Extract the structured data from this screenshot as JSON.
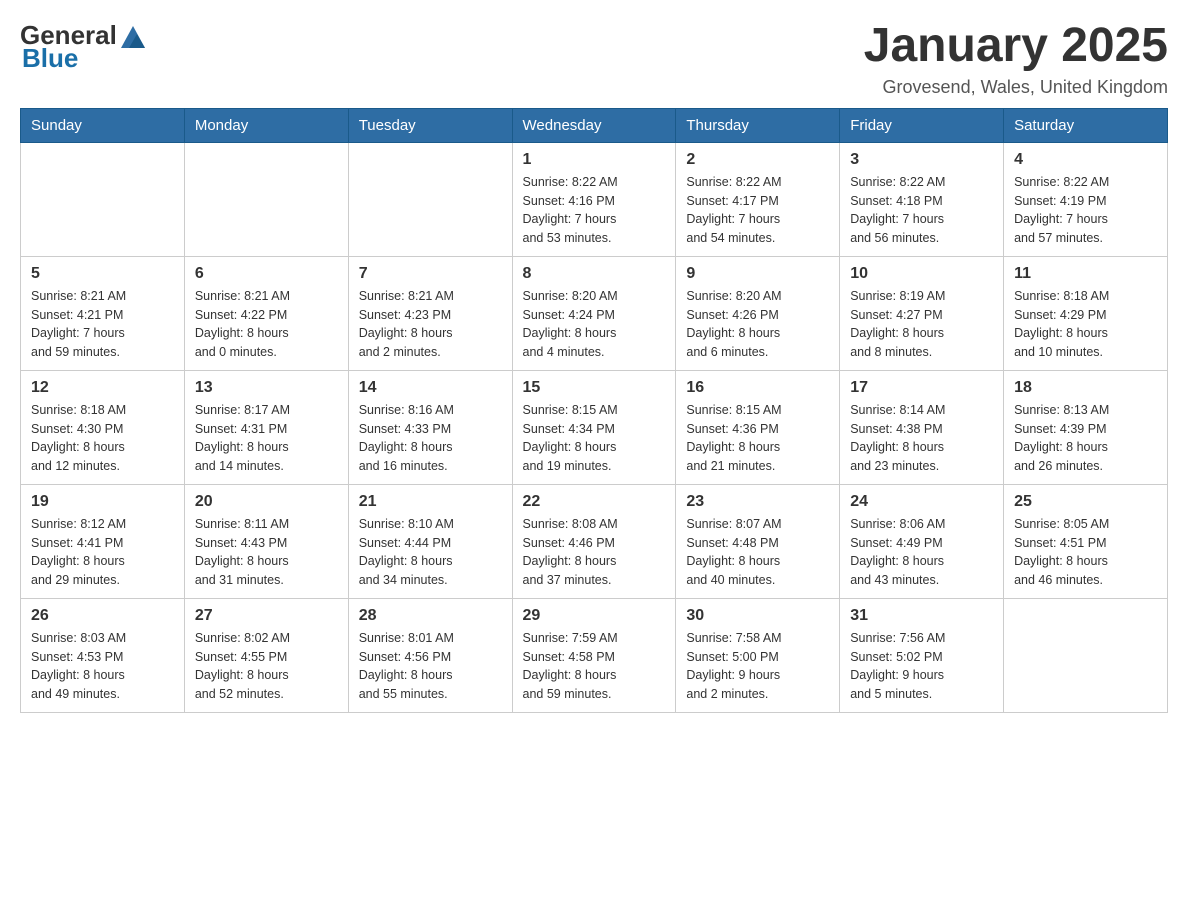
{
  "header": {
    "logo": {
      "general": "General",
      "blue": "Blue"
    },
    "title": "January 2025",
    "location": "Grovesend, Wales, United Kingdom"
  },
  "calendar": {
    "days_of_week": [
      "Sunday",
      "Monday",
      "Tuesday",
      "Wednesday",
      "Thursday",
      "Friday",
      "Saturday"
    ],
    "weeks": [
      [
        {
          "day": "",
          "info": ""
        },
        {
          "day": "",
          "info": ""
        },
        {
          "day": "",
          "info": ""
        },
        {
          "day": "1",
          "info": "Sunrise: 8:22 AM\nSunset: 4:16 PM\nDaylight: 7 hours\nand 53 minutes."
        },
        {
          "day": "2",
          "info": "Sunrise: 8:22 AM\nSunset: 4:17 PM\nDaylight: 7 hours\nand 54 minutes."
        },
        {
          "day": "3",
          "info": "Sunrise: 8:22 AM\nSunset: 4:18 PM\nDaylight: 7 hours\nand 56 minutes."
        },
        {
          "day": "4",
          "info": "Sunrise: 8:22 AM\nSunset: 4:19 PM\nDaylight: 7 hours\nand 57 minutes."
        }
      ],
      [
        {
          "day": "5",
          "info": "Sunrise: 8:21 AM\nSunset: 4:21 PM\nDaylight: 7 hours\nand 59 minutes."
        },
        {
          "day": "6",
          "info": "Sunrise: 8:21 AM\nSunset: 4:22 PM\nDaylight: 8 hours\nand 0 minutes."
        },
        {
          "day": "7",
          "info": "Sunrise: 8:21 AM\nSunset: 4:23 PM\nDaylight: 8 hours\nand 2 minutes."
        },
        {
          "day": "8",
          "info": "Sunrise: 8:20 AM\nSunset: 4:24 PM\nDaylight: 8 hours\nand 4 minutes."
        },
        {
          "day": "9",
          "info": "Sunrise: 8:20 AM\nSunset: 4:26 PM\nDaylight: 8 hours\nand 6 minutes."
        },
        {
          "day": "10",
          "info": "Sunrise: 8:19 AM\nSunset: 4:27 PM\nDaylight: 8 hours\nand 8 minutes."
        },
        {
          "day": "11",
          "info": "Sunrise: 8:18 AM\nSunset: 4:29 PM\nDaylight: 8 hours\nand 10 minutes."
        }
      ],
      [
        {
          "day": "12",
          "info": "Sunrise: 8:18 AM\nSunset: 4:30 PM\nDaylight: 8 hours\nand 12 minutes."
        },
        {
          "day": "13",
          "info": "Sunrise: 8:17 AM\nSunset: 4:31 PM\nDaylight: 8 hours\nand 14 minutes."
        },
        {
          "day": "14",
          "info": "Sunrise: 8:16 AM\nSunset: 4:33 PM\nDaylight: 8 hours\nand 16 minutes."
        },
        {
          "day": "15",
          "info": "Sunrise: 8:15 AM\nSunset: 4:34 PM\nDaylight: 8 hours\nand 19 minutes."
        },
        {
          "day": "16",
          "info": "Sunrise: 8:15 AM\nSunset: 4:36 PM\nDaylight: 8 hours\nand 21 minutes."
        },
        {
          "day": "17",
          "info": "Sunrise: 8:14 AM\nSunset: 4:38 PM\nDaylight: 8 hours\nand 23 minutes."
        },
        {
          "day": "18",
          "info": "Sunrise: 8:13 AM\nSunset: 4:39 PM\nDaylight: 8 hours\nand 26 minutes."
        }
      ],
      [
        {
          "day": "19",
          "info": "Sunrise: 8:12 AM\nSunset: 4:41 PM\nDaylight: 8 hours\nand 29 minutes."
        },
        {
          "day": "20",
          "info": "Sunrise: 8:11 AM\nSunset: 4:43 PM\nDaylight: 8 hours\nand 31 minutes."
        },
        {
          "day": "21",
          "info": "Sunrise: 8:10 AM\nSunset: 4:44 PM\nDaylight: 8 hours\nand 34 minutes."
        },
        {
          "day": "22",
          "info": "Sunrise: 8:08 AM\nSunset: 4:46 PM\nDaylight: 8 hours\nand 37 minutes."
        },
        {
          "day": "23",
          "info": "Sunrise: 8:07 AM\nSunset: 4:48 PM\nDaylight: 8 hours\nand 40 minutes."
        },
        {
          "day": "24",
          "info": "Sunrise: 8:06 AM\nSunset: 4:49 PM\nDaylight: 8 hours\nand 43 minutes."
        },
        {
          "day": "25",
          "info": "Sunrise: 8:05 AM\nSunset: 4:51 PM\nDaylight: 8 hours\nand 46 minutes."
        }
      ],
      [
        {
          "day": "26",
          "info": "Sunrise: 8:03 AM\nSunset: 4:53 PM\nDaylight: 8 hours\nand 49 minutes."
        },
        {
          "day": "27",
          "info": "Sunrise: 8:02 AM\nSunset: 4:55 PM\nDaylight: 8 hours\nand 52 minutes."
        },
        {
          "day": "28",
          "info": "Sunrise: 8:01 AM\nSunset: 4:56 PM\nDaylight: 8 hours\nand 55 minutes."
        },
        {
          "day": "29",
          "info": "Sunrise: 7:59 AM\nSunset: 4:58 PM\nDaylight: 8 hours\nand 59 minutes."
        },
        {
          "day": "30",
          "info": "Sunrise: 7:58 AM\nSunset: 5:00 PM\nDaylight: 9 hours\nand 2 minutes."
        },
        {
          "day": "31",
          "info": "Sunrise: 7:56 AM\nSunset: 5:02 PM\nDaylight: 9 hours\nand 5 minutes."
        },
        {
          "day": "",
          "info": ""
        }
      ]
    ]
  }
}
